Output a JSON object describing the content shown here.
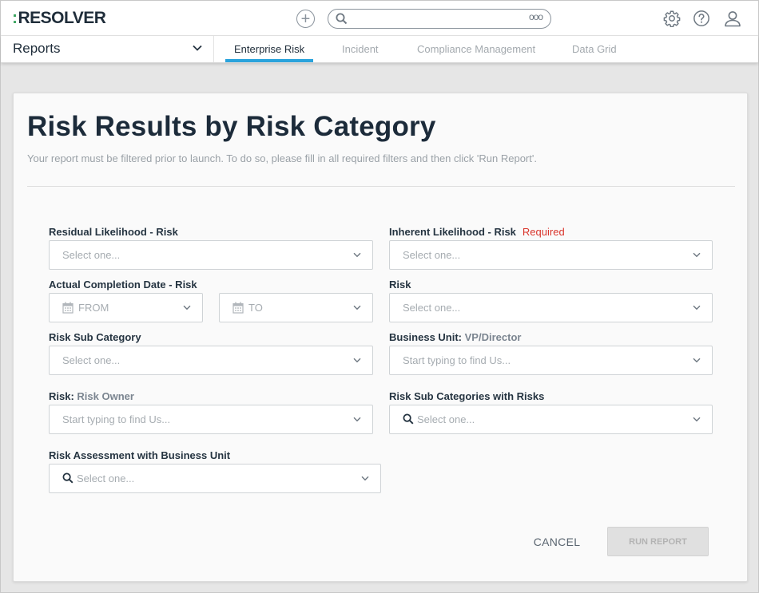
{
  "app": {
    "logo_text": "RESOLVER",
    "logo_prefix": ":",
    "search_placeholder": "",
    "search_more": "ooo",
    "colors": {
      "accent": "#2aa3dc",
      "logo_dots": "#3aa55f",
      "required": "#d9342b"
    }
  },
  "icons": {
    "add": "plus-circle-icon",
    "search": "search-icon",
    "more": "more-dots-icon",
    "settings": "gear-icon",
    "help": "help-icon",
    "user": "user-icon"
  },
  "nav": {
    "reports_label": "Reports",
    "tabs": [
      {
        "label": "Enterprise Risk",
        "active": true
      },
      {
        "label": "Incident",
        "active": false
      },
      {
        "label": "Compliance Management",
        "active": false
      },
      {
        "label": "Data Grid",
        "active": false
      }
    ]
  },
  "report": {
    "title": "Risk Results by Risk Category",
    "subtitle": "Your report must be filtered prior to launch. To do so, please fill in all required filters and then click 'Run Report'.",
    "filters": {
      "residual_likelihood": {
        "label": "Residual Likelihood - Risk",
        "placeholder": "Select one..."
      },
      "inherent_likelihood": {
        "label": "Inherent Likelihood - Risk",
        "required_text": "Required",
        "placeholder": "Select one..."
      },
      "actual_completion": {
        "label": "Actual Completion Date - Risk",
        "from_placeholder": "FROM",
        "to_placeholder": "TO"
      },
      "risk": {
        "label": "Risk",
        "placeholder": "Select one..."
      },
      "risk_sub_category": {
        "label": "Risk Sub Category",
        "placeholder": "Select one..."
      },
      "business_unit": {
        "label": "Business Unit:",
        "label_suffix": "VP/Director",
        "placeholder": "Start typing to find Us..."
      },
      "risk_owner": {
        "label": "Risk:",
        "label_suffix": "Risk Owner",
        "placeholder": "Start typing to find Us..."
      },
      "risk_sub_categories_with_risks": {
        "label": "Risk Sub Categories with Risks",
        "placeholder": "Select one..."
      },
      "risk_assessment": {
        "label": "Risk Assessment with Business Unit",
        "placeholder": "Select one..."
      }
    },
    "actions": {
      "cancel": "CANCEL",
      "run": "RUN REPORT",
      "run_enabled": false
    }
  }
}
